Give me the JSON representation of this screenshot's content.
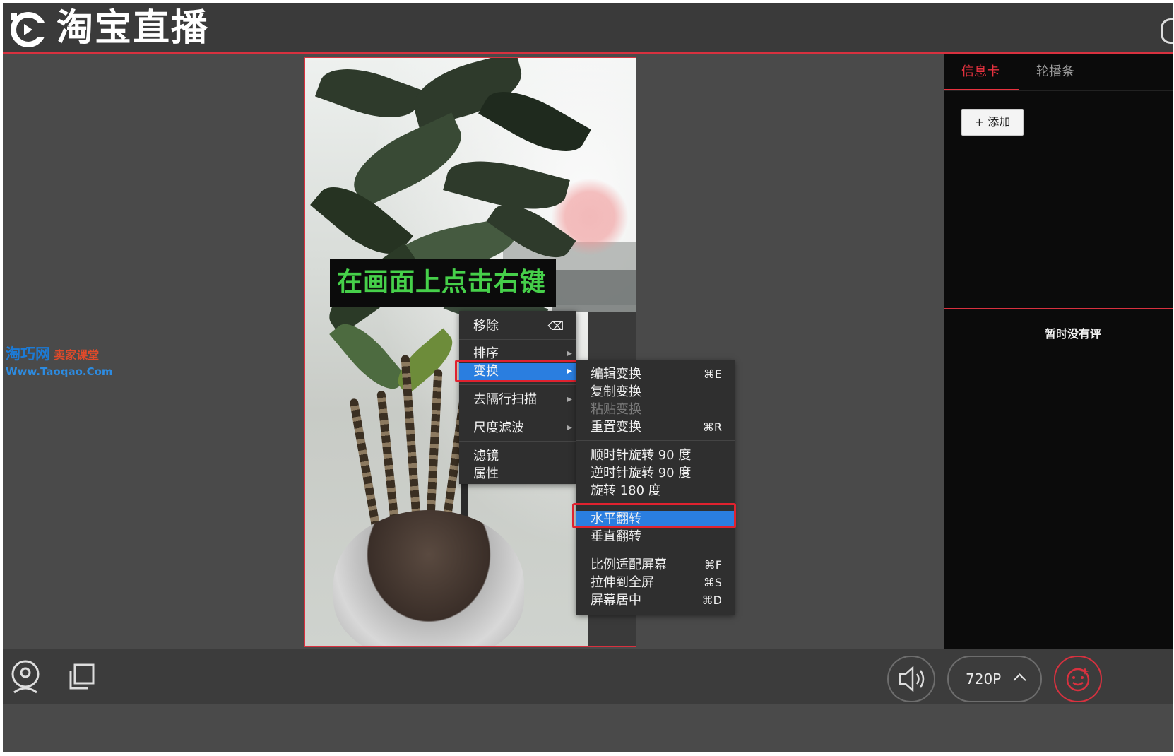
{
  "app": {
    "title": "淘宝直播"
  },
  "overlay_banner": "在画面上点击右键",
  "watermark": {
    "line1": "淘巧网",
    "line1b": "卖家课堂",
    "line2": "Www.Taoqao.Com"
  },
  "context_menu": {
    "items": [
      {
        "label": "移除",
        "shortcut": "⌫"
      },
      {
        "label": "排序",
        "submenu": true
      },
      {
        "label": "变换",
        "submenu": true,
        "highlighted": true
      },
      {
        "label": "去隔行扫描",
        "submenu": true
      },
      {
        "label": "尺度滤波",
        "submenu": true
      },
      {
        "label": "滤镜"
      },
      {
        "label": "属性"
      }
    ]
  },
  "transform_submenu": {
    "items": [
      {
        "label": "编辑变换",
        "shortcut": "⌘E"
      },
      {
        "label": "复制变换",
        "shortcut": ""
      },
      {
        "label": "粘贴变换",
        "shortcut": "",
        "disabled": true
      },
      {
        "label": "重置变换",
        "shortcut": "⌘R"
      },
      {
        "label": "顺时针旋转 90 度",
        "shortcut": ""
      },
      {
        "label": "逆时针旋转 90 度",
        "shortcut": ""
      },
      {
        "label": "旋转 180 度",
        "shortcut": ""
      },
      {
        "label": "水平翻转",
        "shortcut": "",
        "highlighted": true
      },
      {
        "label": "垂直翻转",
        "shortcut": ""
      },
      {
        "label": "比例适配屏幕",
        "shortcut": "⌘F"
      },
      {
        "label": "拉伸到全屏",
        "shortcut": "⌘S"
      },
      {
        "label": "屏幕居中",
        "shortcut": "⌘D"
      }
    ]
  },
  "right_panel": {
    "tabs": [
      "信息卡",
      "轮播条"
    ],
    "active_tab": "信息卡",
    "add_button": "+ 添加",
    "empty_text": "暂时没有评"
  },
  "bottom_bar": {
    "resolution": "720P",
    "icons": [
      "camera-icon",
      "window-capture-icon",
      "volume-icon",
      "chevron-up-icon",
      "beauty-face-icon"
    ]
  },
  "colors": {
    "accent": "#d8313f",
    "highlight": "#2a7ee0",
    "banner_text": "#46d04a"
  }
}
